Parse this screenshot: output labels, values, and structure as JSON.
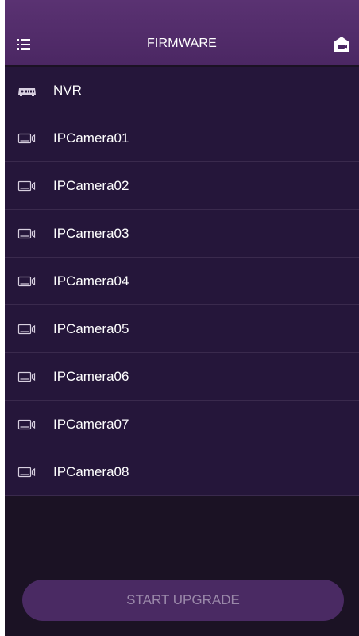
{
  "header": {
    "title": "FIRMWARE",
    "menu_icon": "hamburger-icon",
    "home_icon": "home-camera-icon"
  },
  "devices": [
    {
      "label": "NVR",
      "icon": "nvr-icon"
    },
    {
      "label": "IPCamera01",
      "icon": "camera-icon"
    },
    {
      "label": "IPCamera02",
      "icon": "camera-icon"
    },
    {
      "label": "IPCamera03",
      "icon": "camera-icon"
    },
    {
      "label": "IPCamera04",
      "icon": "camera-icon"
    },
    {
      "label": "IPCamera05",
      "icon": "camera-icon"
    },
    {
      "label": "IPCamera06",
      "icon": "camera-icon"
    },
    {
      "label": "IPCamera07",
      "icon": "camera-icon"
    },
    {
      "label": "IPCamera08",
      "icon": "camera-icon"
    }
  ],
  "action": {
    "upgrade_label": "START UPGRADE"
  },
  "colors": {
    "header_bg": "#4b2763",
    "list_bg": "#25163a",
    "page_bg": "#1b1224",
    "button_bg": "#4a2a63",
    "button_text": "#9a88a9"
  }
}
